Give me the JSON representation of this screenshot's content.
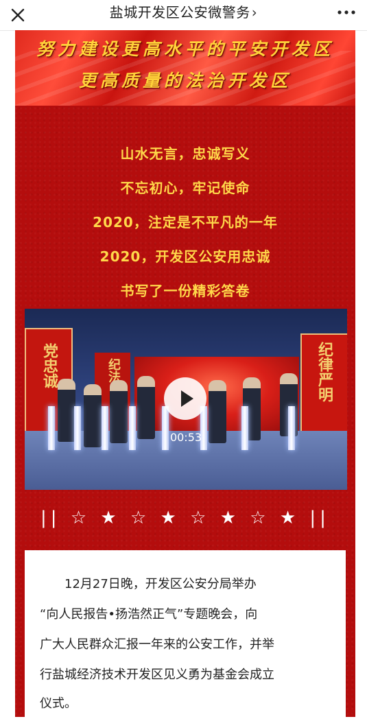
{
  "nav": {
    "title": "盐城开发区公安微警务",
    "chevron": "›",
    "close_icon": "close-icon",
    "more_icon": "more-icon"
  },
  "banner": {
    "line1": "努力建设更高水平的平安开发区",
    "line2": "更高质量的法治开发区"
  },
  "poem": [
    "山水无言，忠诚写义",
    "不忘初心，牢记使命",
    "2020，注定是不平凡的一年",
    "2020，开发区公安用忠诚",
    "书写了一份精彩答卷"
  ],
  "video": {
    "duration": "00:53",
    "left_panel_text": "党忠诚",
    "mid_panel_text": "纪法",
    "right_panel_text": "纪律严明"
  },
  "divider": "|| ☆ ★ ☆ ★ ☆ ★ ☆ ★ ||",
  "article": {
    "lines": [
      "12月27日晚，开发区公安分局举办",
      "“向人民报告•扬浩然正气”专题晚会，向",
      "广大人民群众汇报一年来的公安工作，并举",
      "行盐城经济技术开发区见义勇为基金会成立",
      "仪式。"
    ]
  },
  "colors": {
    "page_red": "#b40d0d",
    "gold_text": "#ffd84a",
    "banner_text": "#ffd23a"
  }
}
